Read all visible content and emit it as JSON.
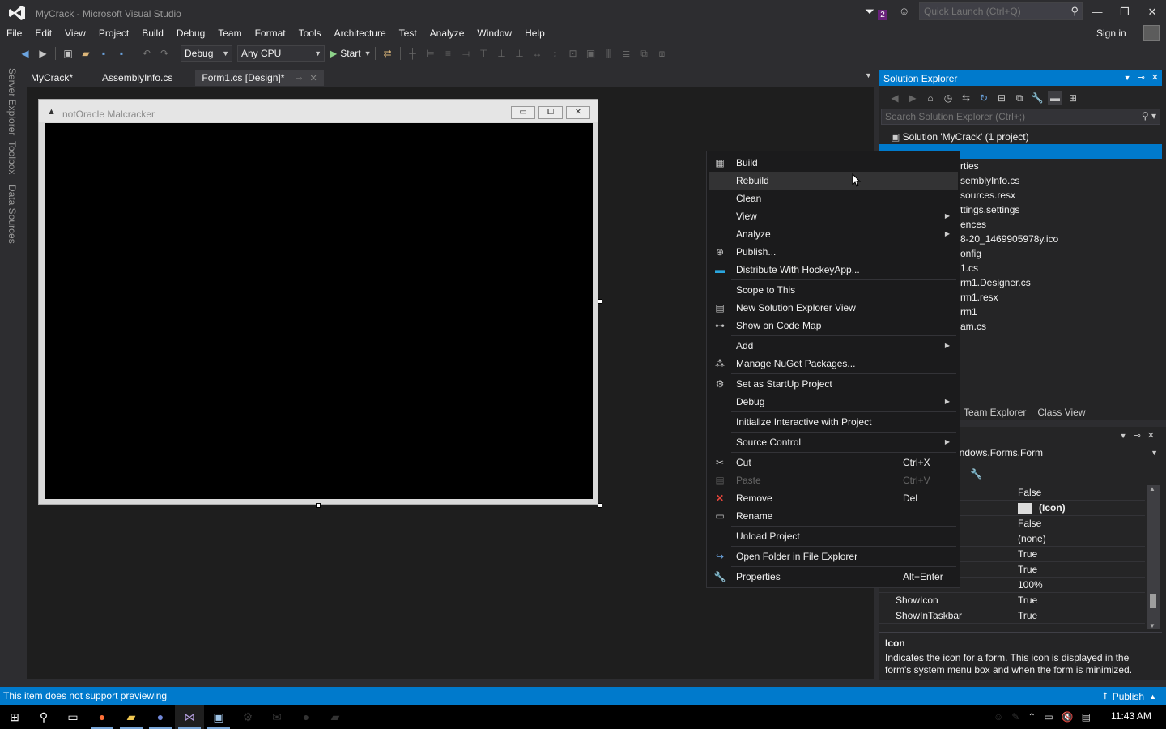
{
  "window": {
    "title": "MyCrack - Microsoft Visual Studio",
    "notification_count": "2",
    "quick_launch_placeholder": "Quick Launch (Ctrl+Q)",
    "sign_in": "Sign in"
  },
  "menu": [
    "File",
    "Edit",
    "View",
    "Project",
    "Build",
    "Debug",
    "Team",
    "Format",
    "Tools",
    "Architecture",
    "Test",
    "Analyze",
    "Window",
    "Help"
  ],
  "toolbar": {
    "config": "Debug",
    "platform": "Any CPU",
    "start": "Start"
  },
  "left_tabs": [
    "Server Explorer",
    "Toolbox",
    "Data Sources"
  ],
  "doc_tabs": [
    {
      "label": "MyCrack*"
    },
    {
      "label": "AssemblyInfo.cs"
    },
    {
      "label": "Form1.cs [Design]*"
    }
  ],
  "form": {
    "title": "notOracle Malcracker"
  },
  "solution_explorer": {
    "title": "Solution Explorer",
    "search_placeholder": "Search Solution Explorer (Ctrl+;)",
    "solution_label": "Solution 'MyCrack' (1 project)",
    "tree": [
      "rties",
      "semblyInfo.cs",
      "sources.resx",
      "ttings.settings",
      "ences",
      "8-20_1469905978y.ico",
      "onfig",
      "1.cs",
      "rm1.Designer.cs",
      "rm1.resx",
      "rm1",
      "am.cs"
    ],
    "bottom_tabs": [
      "Team Explorer",
      "Class View"
    ]
  },
  "properties": {
    "object": "indows.Forms.Form",
    "rows": [
      {
        "name": "",
        "value": "False"
      },
      {
        "name": "",
        "value": "(Icon)"
      },
      {
        "name": "",
        "value": "False"
      },
      {
        "name": "",
        "value": "(none)"
      },
      {
        "name": "",
        "value": "True"
      },
      {
        "name": "",
        "value": "True"
      },
      {
        "name": "",
        "value": "100%"
      },
      {
        "name": "ShowIcon",
        "value": "True"
      },
      {
        "name": "ShowInTaskbar",
        "value": "True"
      }
    ],
    "desc_title": "Icon",
    "desc_text": "Indicates the icon for a form. This icon is displayed in the form's system menu box and when the form is minimized."
  },
  "context_menu": [
    {
      "label": "Build",
      "icon": "build-icon"
    },
    {
      "label": "Rebuild"
    },
    {
      "label": "Clean"
    },
    {
      "label": "View",
      "submenu": true
    },
    {
      "label": "Analyze",
      "submenu": true
    },
    {
      "label": "Publish...",
      "icon": "publish-icon"
    },
    {
      "label": "Distribute With HockeyApp...",
      "icon": "hockeyapp-icon"
    },
    {
      "label": "Scope to This"
    },
    {
      "label": "New Solution Explorer View",
      "icon": "new-view-icon"
    },
    {
      "label": "Show on Code Map",
      "icon": "code-map-icon"
    },
    {
      "label": "Add",
      "submenu": true
    },
    {
      "label": "Manage NuGet Packages...",
      "icon": "nuget-icon"
    },
    {
      "label": "Set as StartUp Project",
      "icon": "gear-icon"
    },
    {
      "label": "Debug",
      "submenu": true
    },
    {
      "label": "Initialize Interactive with Project"
    },
    {
      "label": "Source Control",
      "submenu": true
    },
    {
      "label": "Cut",
      "shortcut": "Ctrl+X",
      "icon": "cut-icon"
    },
    {
      "label": "Paste",
      "shortcut": "Ctrl+V",
      "icon": "paste-icon",
      "disabled": true
    },
    {
      "label": "Remove",
      "shortcut": "Del",
      "icon": "remove-icon"
    },
    {
      "label": "Rename",
      "icon": "rename-icon"
    },
    {
      "label": "Unload Project"
    },
    {
      "label": "Open Folder in File Explorer",
      "icon": "open-folder-icon"
    },
    {
      "label": "Properties",
      "shortcut": "Alt+Enter",
      "icon": "wrench-icon"
    }
  ],
  "status": {
    "text": "This item does not support previewing",
    "publish": "Publish"
  },
  "taskbar": {
    "clock": "11:43 AM"
  },
  "colors": {
    "accent": "#007acc",
    "background": "#2d2d30",
    "menu_bg": "#1b1b1c"
  }
}
